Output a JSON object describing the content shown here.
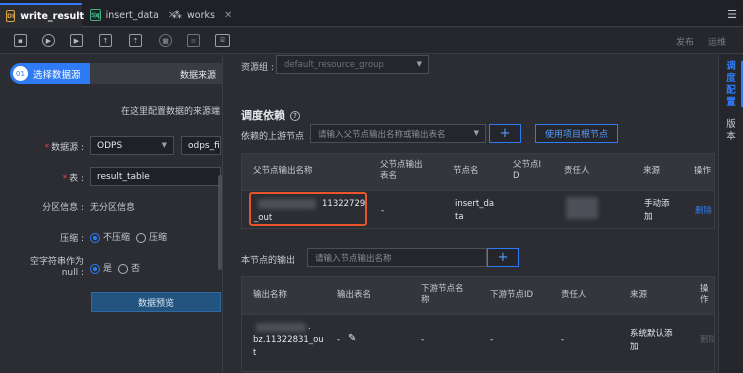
{
  "tabs": [
    {
      "icon": "DI",
      "label": "write_result",
      "close": "✕"
    },
    {
      "icon": "Sq",
      "label": "insert_data",
      "close": "✕"
    },
    {
      "icon": "⁂",
      "label": "works",
      "close": "✕"
    }
  ],
  "toolbar": {
    "publish": "发布",
    "ops": "运维"
  },
  "left": {
    "step_num": "01",
    "step_label": "选择数据源",
    "source_header": "数据来源",
    "desc": "在这里配置数据的来源端",
    "datasource_label": "数据源 :",
    "datasource_type": "ODPS",
    "datasource_name": "odps_firs",
    "table_label": "表 :",
    "table_value": "result_table",
    "partition_label": "分区信息 :",
    "partition_value": "无分区信息",
    "compress_label": "压缩 :",
    "compress_opt1": "不压缩",
    "compress_opt2": "压缩",
    "null_label_1": "空字符串作为",
    "null_label_2": "null :",
    "null_opt1": "是",
    "null_opt2": "否",
    "preview_btn": "数据预览"
  },
  "right": {
    "resource_label": "资源组 :",
    "resource_value": "default_resource_group",
    "section_title": "调度依赖",
    "help": "?",
    "upstream_label": "依赖的上游节点",
    "upstream_placeholder": "请输入父节点输出名称或输出表名",
    "plus": "+",
    "use_project_root": "使用项目根节点",
    "up_headers": [
      "父节点输出名称",
      "父节点输出表名",
      "节点名",
      "父节点I D",
      "责任人",
      "来源",
      "操作"
    ],
    "up_row": {
      "name_a": "11322729",
      "name_b": "_out",
      "table": "-",
      "node_a": "insert_da",
      "node_b": "ta",
      "source_a": "手动添",
      "source_b": "加",
      "action": "删除"
    },
    "output_label": "本节点的输出",
    "output_placeholder": "请输入节点输出名称",
    "out_headers": [
      "输出名称",
      "输出表名",
      "下游节点名称",
      "下游节点ID",
      "责任人",
      "来源",
      "操作"
    ],
    "out_row": {
      "name_a": ".",
      "name_b": "bz.11322831_ou",
      "name_c": "t",
      "table": "-",
      "down_name": "-",
      "down_id": "-",
      "owner": "-",
      "source_a": "系统默认添",
      "source_b": "加",
      "action": "删除"
    }
  },
  "sidetabs": {
    "schedule": "调度配置",
    "version": "版本"
  }
}
